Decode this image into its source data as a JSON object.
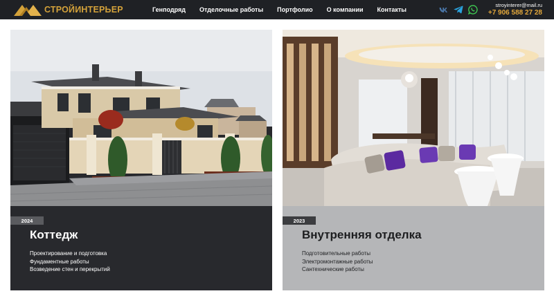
{
  "header": {
    "logo_text": "СТРОЙИНТЕРЬЕР",
    "nav": [
      "Генподряд",
      "Отделочные работы",
      "Портфолио",
      "О компании",
      "Контакты"
    ],
    "social": [
      {
        "name": "vk-icon",
        "color": "#4a76a8"
      },
      {
        "name": "telegram-icon",
        "color": "#2aa3df"
      },
      {
        "name": "whatsapp-icon",
        "color": "#3ec651"
      }
    ],
    "email": "stroyinterer@mail.ru",
    "phone": "+7 906 588 27 28",
    "colors": {
      "background": "#1f2125",
      "accent": "#e2a73b"
    }
  },
  "cards": [
    {
      "year": "2024",
      "title": "Коттедж",
      "items": [
        "Проектирование и подготовка",
        "Фундаментные работы",
        "Возведение стен и перекрытий"
      ],
      "background": "#28292d"
    },
    {
      "year": "2023",
      "title": "Внутренняя отделка",
      "items": [
        "Подготовительные работы",
        "Электромонтажные работы",
        "Сантехнические работы"
      ],
      "background": "#b5b6b8"
    }
  ]
}
